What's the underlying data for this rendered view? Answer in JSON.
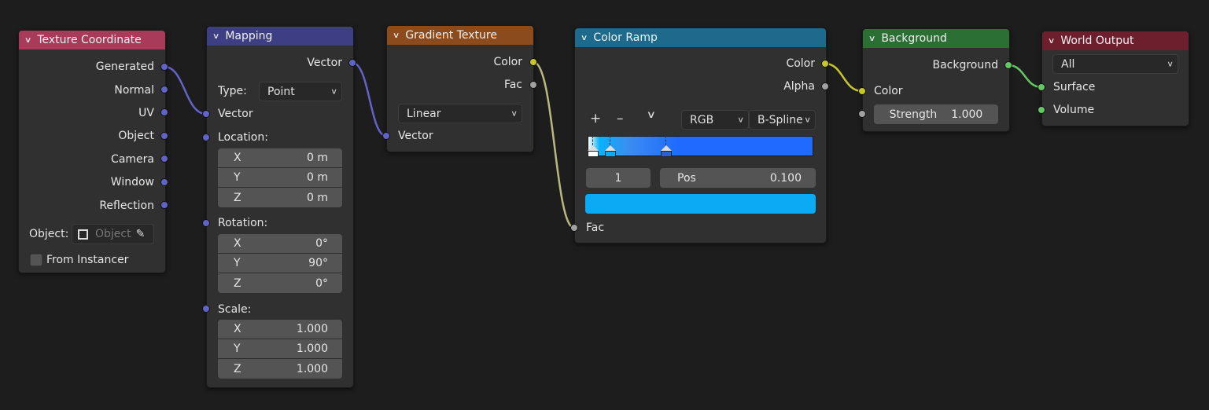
{
  "nodes": {
    "texture_coordinate": {
      "title": "Texture Coordinate",
      "outputs": [
        "Generated",
        "Normal",
        "UV",
        "Object",
        "Camera",
        "Window",
        "Reflection"
      ],
      "object_label": "Object:",
      "object_placeholder": "Object",
      "from_instancer_label": "From Instancer",
      "from_instancer_checked": false,
      "color": "#a83a5a"
    },
    "mapping": {
      "title": "Mapping",
      "output": "Vector",
      "type_label": "Type:",
      "type_value": "Point",
      "input_vector": "Vector",
      "location_label": "Location:",
      "location": [
        {
          "axis": "X",
          "value": "0 m"
        },
        {
          "axis": "Y",
          "value": "0 m"
        },
        {
          "axis": "Z",
          "value": "0 m"
        }
      ],
      "rotation_label": "Rotation:",
      "rotation": [
        {
          "axis": "X",
          "value": "0°"
        },
        {
          "axis": "Y",
          "value": "90°"
        },
        {
          "axis": "Z",
          "value": "0°"
        }
      ],
      "scale_label": "Scale:",
      "scale": [
        {
          "axis": "X",
          "value": "1.000"
        },
        {
          "axis": "Y",
          "value": "1.000"
        },
        {
          "axis": "Z",
          "value": "1.000"
        }
      ],
      "color": "#3e3e84"
    },
    "gradient_texture": {
      "title": "Gradient Texture",
      "outputs": [
        "Color",
        "Fac"
      ],
      "type_value": "Linear",
      "input_vector": "Vector",
      "color": "#8c4b1d"
    },
    "color_ramp": {
      "title": "Color Ramp",
      "outputs": [
        "Color",
        "Alpha"
      ],
      "add_symbol": "+",
      "remove_symbol": "–",
      "menu_symbol": "⌄",
      "color_mode": "RGB",
      "interpolation": "B-Spline",
      "active_index": "1",
      "pos_label": "Pos",
      "pos_value": "0.100",
      "active_color": "#0aaaf5",
      "stops": [
        {
          "position": 0.0,
          "color": "#ffffff"
        },
        {
          "position": 0.1,
          "color": "#0aaaf5"
        },
        {
          "position": 0.35,
          "color": "#2a5fd6"
        }
      ],
      "input_fac": "Fac",
      "color": "#1d6a8c"
    },
    "background": {
      "title": "Background",
      "output": "Background",
      "input_color": "Color",
      "strength_label": "Strength",
      "strength_value": "1.000",
      "color": "#2b6f34"
    },
    "world_output": {
      "title": "World Output",
      "target": "All",
      "inputs": [
        "Surface",
        "Volume"
      ],
      "color": "#6e1f2d"
    }
  }
}
